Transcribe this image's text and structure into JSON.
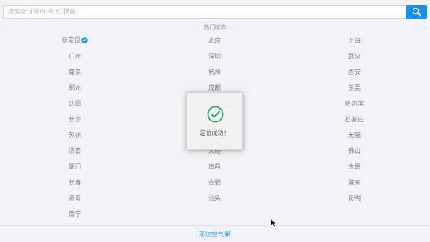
{
  "search": {
    "placeholder": "搜索全球城市(中文/拼音)"
  },
  "section": {
    "title": "热门城市"
  },
  "locate": {
    "label": "定位"
  },
  "cities": [
    "北京",
    "上海",
    "广州",
    "深圳",
    "武汉",
    "南京",
    "杭州",
    "西安",
    "郑州",
    "成都",
    "东莞",
    "沈阳",
    "哈尔滨",
    "长沙",
    "石家庄",
    "苏州",
    "无锡",
    "济南",
    "大连",
    "佛山",
    "厦门",
    "南昌",
    "太原",
    "长春",
    "合肥",
    "浦东",
    "青岛",
    "汕头",
    "昆明",
    "南宁"
  ],
  "toast": {
    "message": "定位成功！"
  },
  "footer": {
    "add_label": "添加空气果"
  },
  "colors": {
    "accent": "#1f8fe5",
    "success": "#2ea86a",
    "background": "#f2f3f6"
  }
}
